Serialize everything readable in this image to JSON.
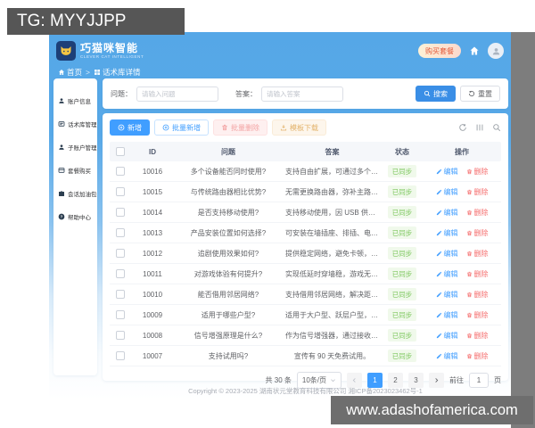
{
  "watermarks": {
    "tg": "TG: MYYJJPP",
    "site": "www.adashofamerica.com"
  },
  "header": {
    "brand": {
      "title": "巧猫咪智能",
      "subtitle": "CLEVER CAT INTELLIGENT"
    },
    "buy_badge": "购买套餐",
    "breadcrumb": {
      "home": "首页",
      "separator": ">",
      "current": "话术库详情"
    }
  },
  "sidebar": {
    "items": [
      {
        "label": "账户信息",
        "icon": "user-icon"
      },
      {
        "label": "话术库管理",
        "icon": "library-icon"
      },
      {
        "label": "子账户管理",
        "icon": "subaccount-icon"
      },
      {
        "label": "套餐购买",
        "icon": "package-icon"
      },
      {
        "label": "会话加油包",
        "icon": "briefcase-icon"
      },
      {
        "label": "帮助中心",
        "icon": "help-icon"
      }
    ]
  },
  "filter": {
    "question_label": "问题：",
    "question_placeholder": "请输入问题",
    "answer_label": "答案：",
    "answer_placeholder": "请输入答案",
    "search_label": "搜索",
    "reset_label": "重置"
  },
  "toolbar": {
    "add": "新增",
    "batch_add": "批量新增",
    "batch_delete": "批量删除",
    "template_download": "模板下载"
  },
  "table": {
    "columns": {
      "id": "ID",
      "question": "问题",
      "answer": "答案",
      "status": "状态",
      "operation": "操作"
    },
    "edit_label": "编辑",
    "delete_label": "删除",
    "rows": [
      {
        "id": "10016",
        "question": "多个设备能否同时使用?",
        "answer": "支持自由扩展，可通过多个设备搭配使用，全...",
        "status": "已同步"
      },
      {
        "id": "10015",
        "question": "与传统路由器相比优势?",
        "answer": "无需更换路由器，弥补主路由覆盖不足，即插...",
        "status": "已同步"
      },
      {
        "id": "10014",
        "question": "是否支持移动使用?",
        "answer": "支持移动使用，因 USB 供电，可搭配移动电...",
        "status": "已同步"
      },
      {
        "id": "10013",
        "question": "产品安装位置如何选择?",
        "answer": "可安装在墙插座、排插、电脑 USB 接口等位...",
        "status": "已同步"
      },
      {
        "id": "10012",
        "question": "追剧使用效果如何?",
        "answer": "提供稳定网络，避免卡顿，满足追剧无忧的使...",
        "status": "已同步"
      },
      {
        "id": "10011",
        "question": "对游戏体验有何提升?",
        "answer": "实现低延时穿墙稳，游戏无延迟，保障电竞等...",
        "status": "已同步"
      },
      {
        "id": "10010",
        "question": "能否借用邻居网络?",
        "answer": "支持借用邻居网络，解决距离远、信号差的联...",
        "status": "已同步"
      },
      {
        "id": "10009",
        "question": "适用于哪些户型?",
        "answer": "适用于大户型、跃层户型，解决因空间大、墙...",
        "status": "已同步"
      },
      {
        "id": "10008",
        "question": "信号增强原理是什么?",
        "answer": "作为信号增强器，通过接收主路由信号并放大...",
        "status": "已同步"
      },
      {
        "id": "10007",
        "question": "支持试用吗?",
        "answer": "宣传有 90 天免费试用。",
        "status": "已同步"
      }
    ]
  },
  "pagination": {
    "total": "共 30 条",
    "page_size": "10条/页",
    "pages": [
      "1",
      "2",
      "3"
    ],
    "active_page": "1",
    "goto_label": "前往",
    "goto_value": "1",
    "goto_suffix": "页"
  },
  "footer": {
    "copyright": "Copyright © 2023-2025 湖南状元堂教育科技有限公司 湘ICP备2023023462号-1"
  },
  "colors": {
    "header_blue": "#55a7e7",
    "primary_blue": "#409eff",
    "success_green": "#7cc75c",
    "success_bg": "#f0f9eb",
    "danger_red": "#f56c6c",
    "badge_text": "#e25a3a"
  }
}
